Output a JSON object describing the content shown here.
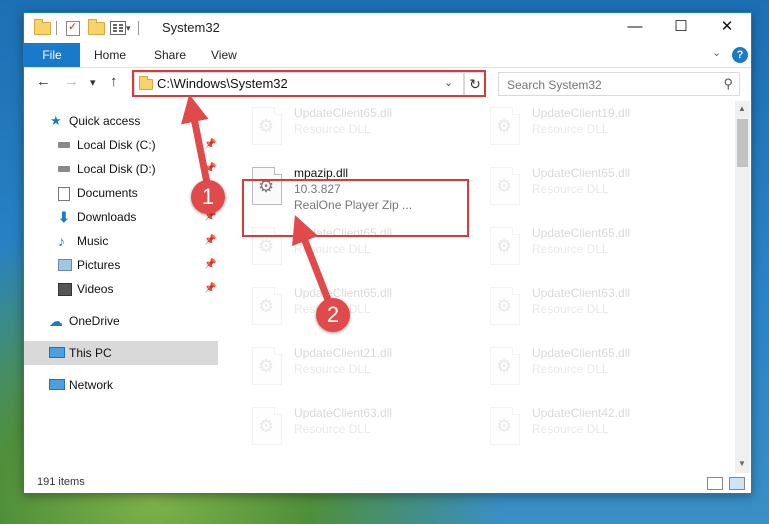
{
  "window": {
    "title": "System32",
    "controls": {
      "minimize": "—",
      "maximize": "☐",
      "close": "✕"
    }
  },
  "ribbon": {
    "file_tab": "File",
    "tabs": [
      "Home",
      "Share",
      "View"
    ],
    "help": "?"
  },
  "navigation": {
    "back": "←",
    "forward": "→",
    "recent": "▾",
    "up": "↑",
    "address": "C:\\Windows\\System32",
    "refresh": "↻"
  },
  "search": {
    "placeholder": "Search System32"
  },
  "sidebar": {
    "items": [
      {
        "label": "Quick access",
        "icon": "star-icon",
        "pinned": false
      },
      {
        "label": "Local Disk (C:)",
        "icon": "drive-icon",
        "pinned": true
      },
      {
        "label": "Local Disk (D:)",
        "icon": "drive-icon",
        "pinned": true
      },
      {
        "label": "Documents",
        "icon": "documents-icon",
        "pinned": true
      },
      {
        "label": "Downloads",
        "icon": "downloads-icon",
        "pinned": true
      },
      {
        "label": "Music",
        "icon": "music-icon",
        "pinned": true
      },
      {
        "label": "Pictures",
        "icon": "pictures-icon",
        "pinned": true
      },
      {
        "label": "Videos",
        "icon": "videos-icon",
        "pinned": true
      },
      {
        "label": "OneDrive",
        "icon": "cloud-icon",
        "pinned": false
      },
      {
        "label": "This PC",
        "icon": "computer-icon",
        "pinned": false,
        "selected": true
      },
      {
        "label": "Network",
        "icon": "network-icon",
        "pinned": false
      }
    ]
  },
  "files": {
    "left": [
      {
        "name": "UpdateClient65.dll",
        "type": "Resource DLL"
      },
      {
        "name": "mpazip.dll",
        "version": "10.3.827",
        "description": "RealOne Player Zip ...",
        "highlighted": true
      },
      {
        "name": "UpdateClient65.dll",
        "type": "Resource DLL"
      },
      {
        "name": "UpdateClient65.dll",
        "type": "Resource DLL"
      },
      {
        "name": "UpdateClient21.dll",
        "type": "Resource DLL"
      },
      {
        "name": "UpdateClient63.dll",
        "type": "Resource DLL"
      }
    ],
    "right": [
      {
        "name": "UpdateClient19.dll",
        "type": "Resource DLL"
      },
      {
        "name": "UpdateClient65.dll",
        "type": "Resource DLL"
      },
      {
        "name": "UpdateClient65.dll",
        "type": "Resource DLL"
      },
      {
        "name": "UpdateClient63.dll",
        "type": "Resource DLL"
      },
      {
        "name": "UpdateClient65.dll",
        "type": "Resource DLL"
      },
      {
        "name": "UpdateClient42.dll",
        "type": "Resource DLL"
      }
    ]
  },
  "status": {
    "items": "191 items"
  },
  "annotations": {
    "step1": "1",
    "step2": "2",
    "accent": "#d63a3a"
  },
  "colors": {
    "ribbon_blue": "#1979ca",
    "selected_bg": "#d9d9d9"
  }
}
